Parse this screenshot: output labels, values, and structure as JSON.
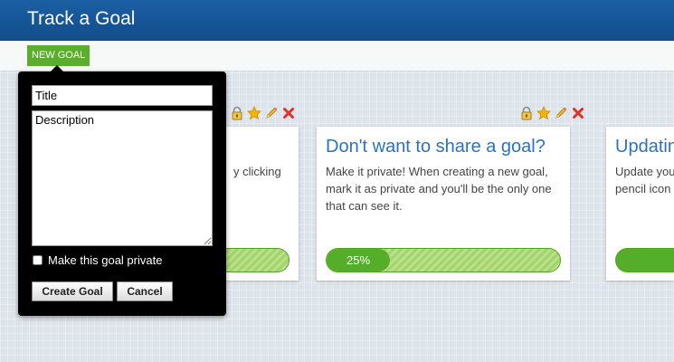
{
  "header": {
    "title": "Track a Goal"
  },
  "toolbar": {
    "new_goal_label": "NEW GOAL"
  },
  "cards": [
    {
      "title": "",
      "description_lines": [
        "",
        "y clicking",
        "",
        ""
      ],
      "progress": null
    },
    {
      "title": "Don't want to share a goal?",
      "description_lines": [
        "Make it private! When creating a new goal,",
        "mark it as private and you'll be the only one",
        "that can see it."
      ],
      "progress": {
        "value": 25,
        "label": "25%"
      }
    },
    {
      "title": "Updatin",
      "description_lines": [
        "Update you",
        "pencil icon"
      ],
      "progress": null
    }
  ],
  "card_actions": [
    "lock-icon",
    "star-icon",
    "pencil-icon",
    "delete-icon"
  ],
  "popup": {
    "title_placeholder": "Title",
    "description_placeholder": "Description",
    "private_label": "Make this goal private",
    "private_checked": false,
    "create_label": "Create Goal",
    "cancel_label": "Cancel"
  },
  "colors": {
    "header_blue": "#1a5fa3",
    "accent_green": "#5aad2d",
    "link_blue": "#2a73c4",
    "delete_red": "#e0312c",
    "star_gold": "#f2b500"
  }
}
